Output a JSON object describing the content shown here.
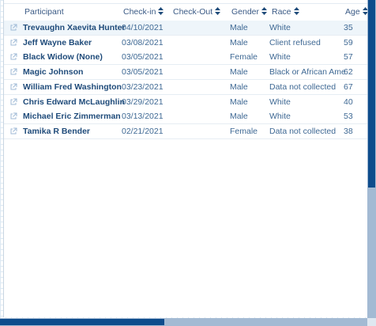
{
  "table": {
    "headers": {
      "participant": "Participant",
      "checkin": "Check-in",
      "checkout": "Check-Out",
      "gender": "Gender",
      "race": "Race",
      "age": "Age"
    },
    "rows": [
      {
        "participant": "Trevaughn Xaevita Hunter",
        "checkin": "04/10/2021",
        "checkout": "",
        "gender": "Male",
        "race": "White",
        "age": "35"
      },
      {
        "participant": "Jeff Wayne Baker",
        "checkin": "03/08/2021",
        "checkout": "",
        "gender": "Male",
        "race": "Client refused",
        "age": "59"
      },
      {
        "participant": "Black Widow (None)",
        "checkin": "03/05/2021",
        "checkout": "",
        "gender": "Female",
        "race": "White",
        "age": "57"
      },
      {
        "participant": "Magic Johnson",
        "checkin": "03/05/2021",
        "checkout": "",
        "gender": "Male",
        "race": "Black or African American",
        "age": "62"
      },
      {
        "participant": "William Fred Washington",
        "checkin": "03/23/2021",
        "checkout": "",
        "gender": "Male",
        "race": "Data not collected",
        "age": "67"
      },
      {
        "participant": "Chris Edward McLaughlin",
        "checkin": "03/29/2021",
        "checkout": "",
        "gender": "Male",
        "race": "White",
        "age": "40"
      },
      {
        "participant": "Michael Eric Zimmerman",
        "checkin": "03/13/2021",
        "checkout": "",
        "gender": "Male",
        "race": "White",
        "age": "53"
      },
      {
        "participant": "Tamika R Bender",
        "checkin": "02/21/2021",
        "checkout": "",
        "gender": "Female",
        "race": "Data not collected",
        "age": "38"
      }
    ]
  },
  "icons": {
    "row_link": "external-link-icon",
    "sort": "sort-arrows-icon"
  },
  "colors": {
    "header_text": "#3a5a85",
    "name_text": "#1f4b7a",
    "cell_text": "#3f6994",
    "scroll_thumb": "#0e4c8c",
    "scroll_track": "#a3bad3"
  }
}
